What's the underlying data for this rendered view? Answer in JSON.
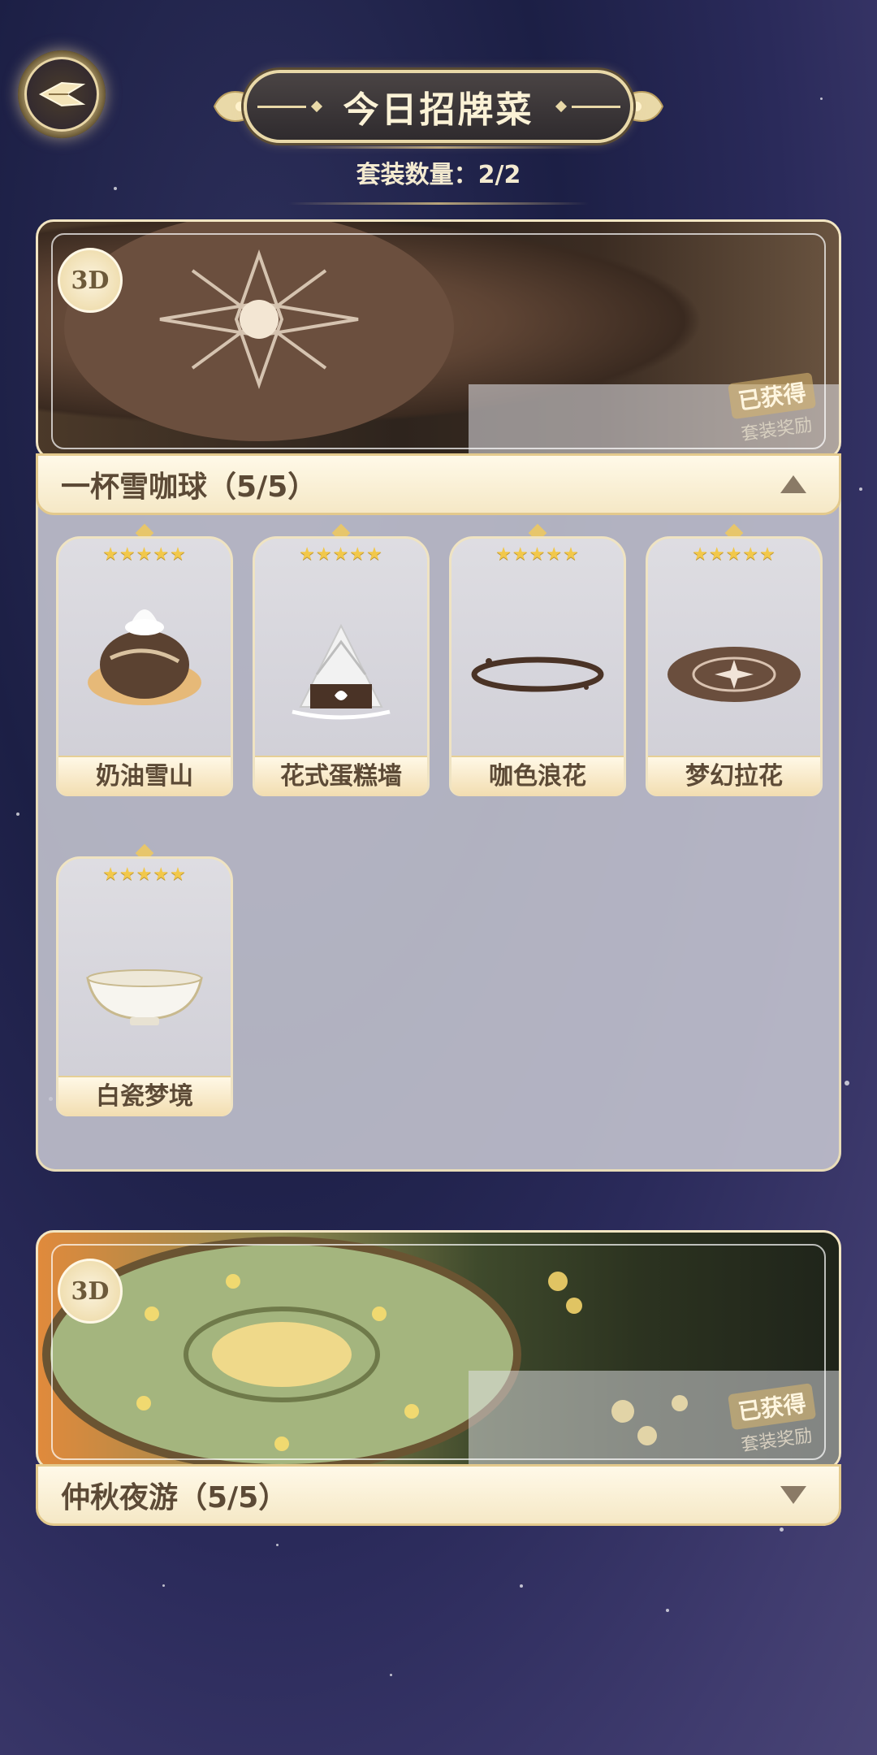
{
  "header": {
    "title": "今日招牌菜",
    "set_count_label": "套装数量：2/2"
  },
  "sets": [
    {
      "name": "一杯雪咖球（5/5）",
      "badge": "3D",
      "owned_label": "已获得",
      "reward_label": "套装奖励",
      "expanded": true,
      "items": [
        {
          "name": "奶油雪山",
          "stars": "★★★★★"
        },
        {
          "name": "花式蛋糕墙",
          "stars": "★★★★★"
        },
        {
          "name": "咖色浪花",
          "stars": "★★★★★"
        },
        {
          "name": "梦幻拉花",
          "stars": "★★★★★"
        },
        {
          "name": "白瓷梦境",
          "stars": "★★★★★"
        }
      ]
    },
    {
      "name": "仲秋夜游（5/5）",
      "badge": "3D",
      "owned_label": "已获得",
      "reward_label": "套装奖励",
      "expanded": false
    }
  ],
  "colors": {
    "gold": "#e9d9a8",
    "cream": "#fff9e8",
    "text_brown": "#5c4a36",
    "star": "#f2c84a"
  },
  "icons": {
    "back": "back-wing-icon",
    "collapse": "caret-up-icon",
    "expand": "caret-down-icon"
  }
}
